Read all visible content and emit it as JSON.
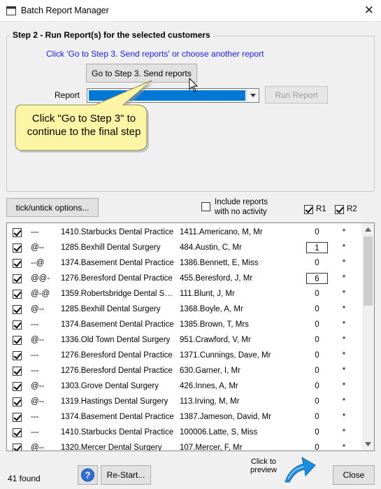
{
  "window": {
    "title": "Batch Report Manager",
    "close_glyph": "✕"
  },
  "step": {
    "legend": "Step 2 - Run Report(s) for the selected customers",
    "hint": "Click 'Go to Step 3. Send reports' or choose another report",
    "goto_button": "Go to Step 3. Send reports",
    "report_label": "Report",
    "run_button": "Run Report"
  },
  "callout": {
    "line1": "Click \"Go to Step 3\" to",
    "line2": "continue to the final step"
  },
  "options": {
    "tick_button": "tick/untick options...",
    "include_line1": "Include reports",
    "include_line2": "with no activity",
    "r1": "R1",
    "r2": "R2"
  },
  "rows": [
    {
      "flag": "---",
      "practice": "1410.Starbucks Dental Practice",
      "client": "1411.Americano, M, Mr",
      "r1": "0",
      "r1_boxed": false,
      "r2": "*"
    },
    {
      "flag": "@--",
      "practice": "1285.Bexhill Dental Surgery",
      "client": "484.Austin, C, Mr",
      "r1": "1",
      "r1_boxed": true,
      "r2": "*"
    },
    {
      "flag": "--@",
      "practice": "1374.Basement Dental Practice",
      "client": "1386.Bennett, E, Miss",
      "r1": "0",
      "r1_boxed": false,
      "r2": "*"
    },
    {
      "flag": "@@-",
      "practice": "1276.Beresford Dental Practice",
      "client": "455.Beresford, J, Mr",
      "r1": "6",
      "r1_boxed": true,
      "r2": "*"
    },
    {
      "flag": "@-@",
      "practice": "1359.Robertsbridge Dental Su...",
      "client": "111.Blunt, J, Mr",
      "r1": "0",
      "r1_boxed": false,
      "r2": "*"
    },
    {
      "flag": "@--",
      "practice": "1285.Bexhill Dental Surgery",
      "client": "1368.Boyle, A, Mr",
      "r1": "0",
      "r1_boxed": false,
      "r2": "*"
    },
    {
      "flag": "---",
      "practice": "1374.Basement Dental Practice",
      "client": "1385.Brown, T, Mrs",
      "r1": "0",
      "r1_boxed": false,
      "r2": "*"
    },
    {
      "flag": "@--",
      "practice": "1336.Old Town Dental Surgery",
      "client": "951.Crawford, V, Mr",
      "r1": "0",
      "r1_boxed": false,
      "r2": "*"
    },
    {
      "flag": "---",
      "practice": "1276.Beresford Dental Practice",
      "client": "1371.Cunnings, Dave, Mr",
      "r1": "0",
      "r1_boxed": false,
      "r2": "*"
    },
    {
      "flag": "---",
      "practice": "1276.Beresford Dental Practice",
      "client": "630.Garner, I, Mr",
      "r1": "0",
      "r1_boxed": false,
      "r2": "*"
    },
    {
      "flag": "@--",
      "practice": "1303.Grove Dental Surgery",
      "client": "426.Innes, A, Mr",
      "r1": "0",
      "r1_boxed": false,
      "r2": "*"
    },
    {
      "flag": "@--",
      "practice": "1319.Hastings Dental Surgery",
      "client": "113.Irving, M, Mr",
      "r1": "0",
      "r1_boxed": false,
      "r2": "*"
    },
    {
      "flag": "---",
      "practice": "1374.Basement Dental Practice",
      "client": "1387.Jameson, David, Mr",
      "r1": "0",
      "r1_boxed": false,
      "r2": "*"
    },
    {
      "flag": "---",
      "practice": "1410.Starbucks Dental Practice",
      "client": "100006.Latte, S, Miss",
      "r1": "0",
      "r1_boxed": false,
      "r2": "*"
    },
    {
      "flag": "@--",
      "practice": "1320.Mercer Dental Surgery",
      "client": "107.Mercer, F, Mr",
      "r1": "0",
      "r1_boxed": false,
      "r2": "*"
    }
  ],
  "footer": {
    "found": "41  found",
    "restart_button": "Re-Start...",
    "preview_line1": "Click to",
    "preview_line2": "preview",
    "close_button": "Close"
  },
  "colors": {
    "hint": "#1a1ae6",
    "selection": "#0078d7",
    "callout": "#fdf5a6",
    "arrow": "#1e8fe0"
  },
  "icons": [
    "app-window-icon",
    "close-icon",
    "dropdown-arrow-icon",
    "mouse-pointer-icon",
    "help-icon",
    "preview-arrow-icon"
  ]
}
